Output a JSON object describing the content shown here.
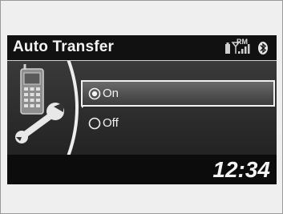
{
  "header": {
    "title": "Auto Transfer",
    "status": {
      "battery_icon": "battery-icon",
      "signal_icon": "signal-icon",
      "roaming_label": "RM",
      "bluetooth_icon": "bluetooth-icon"
    }
  },
  "panel": {
    "icon_names": [
      "phone-icon",
      "wrench-icon"
    ]
  },
  "options": [
    {
      "label": "On",
      "selected": true
    },
    {
      "label": "Off",
      "selected": false
    }
  ],
  "footer": {
    "clock": "12:34"
  },
  "colors": {
    "screen": "#262626",
    "title_bar": "#111111",
    "highlight_border": "#f0f0f0",
    "text": "#f2f2f2"
  }
}
